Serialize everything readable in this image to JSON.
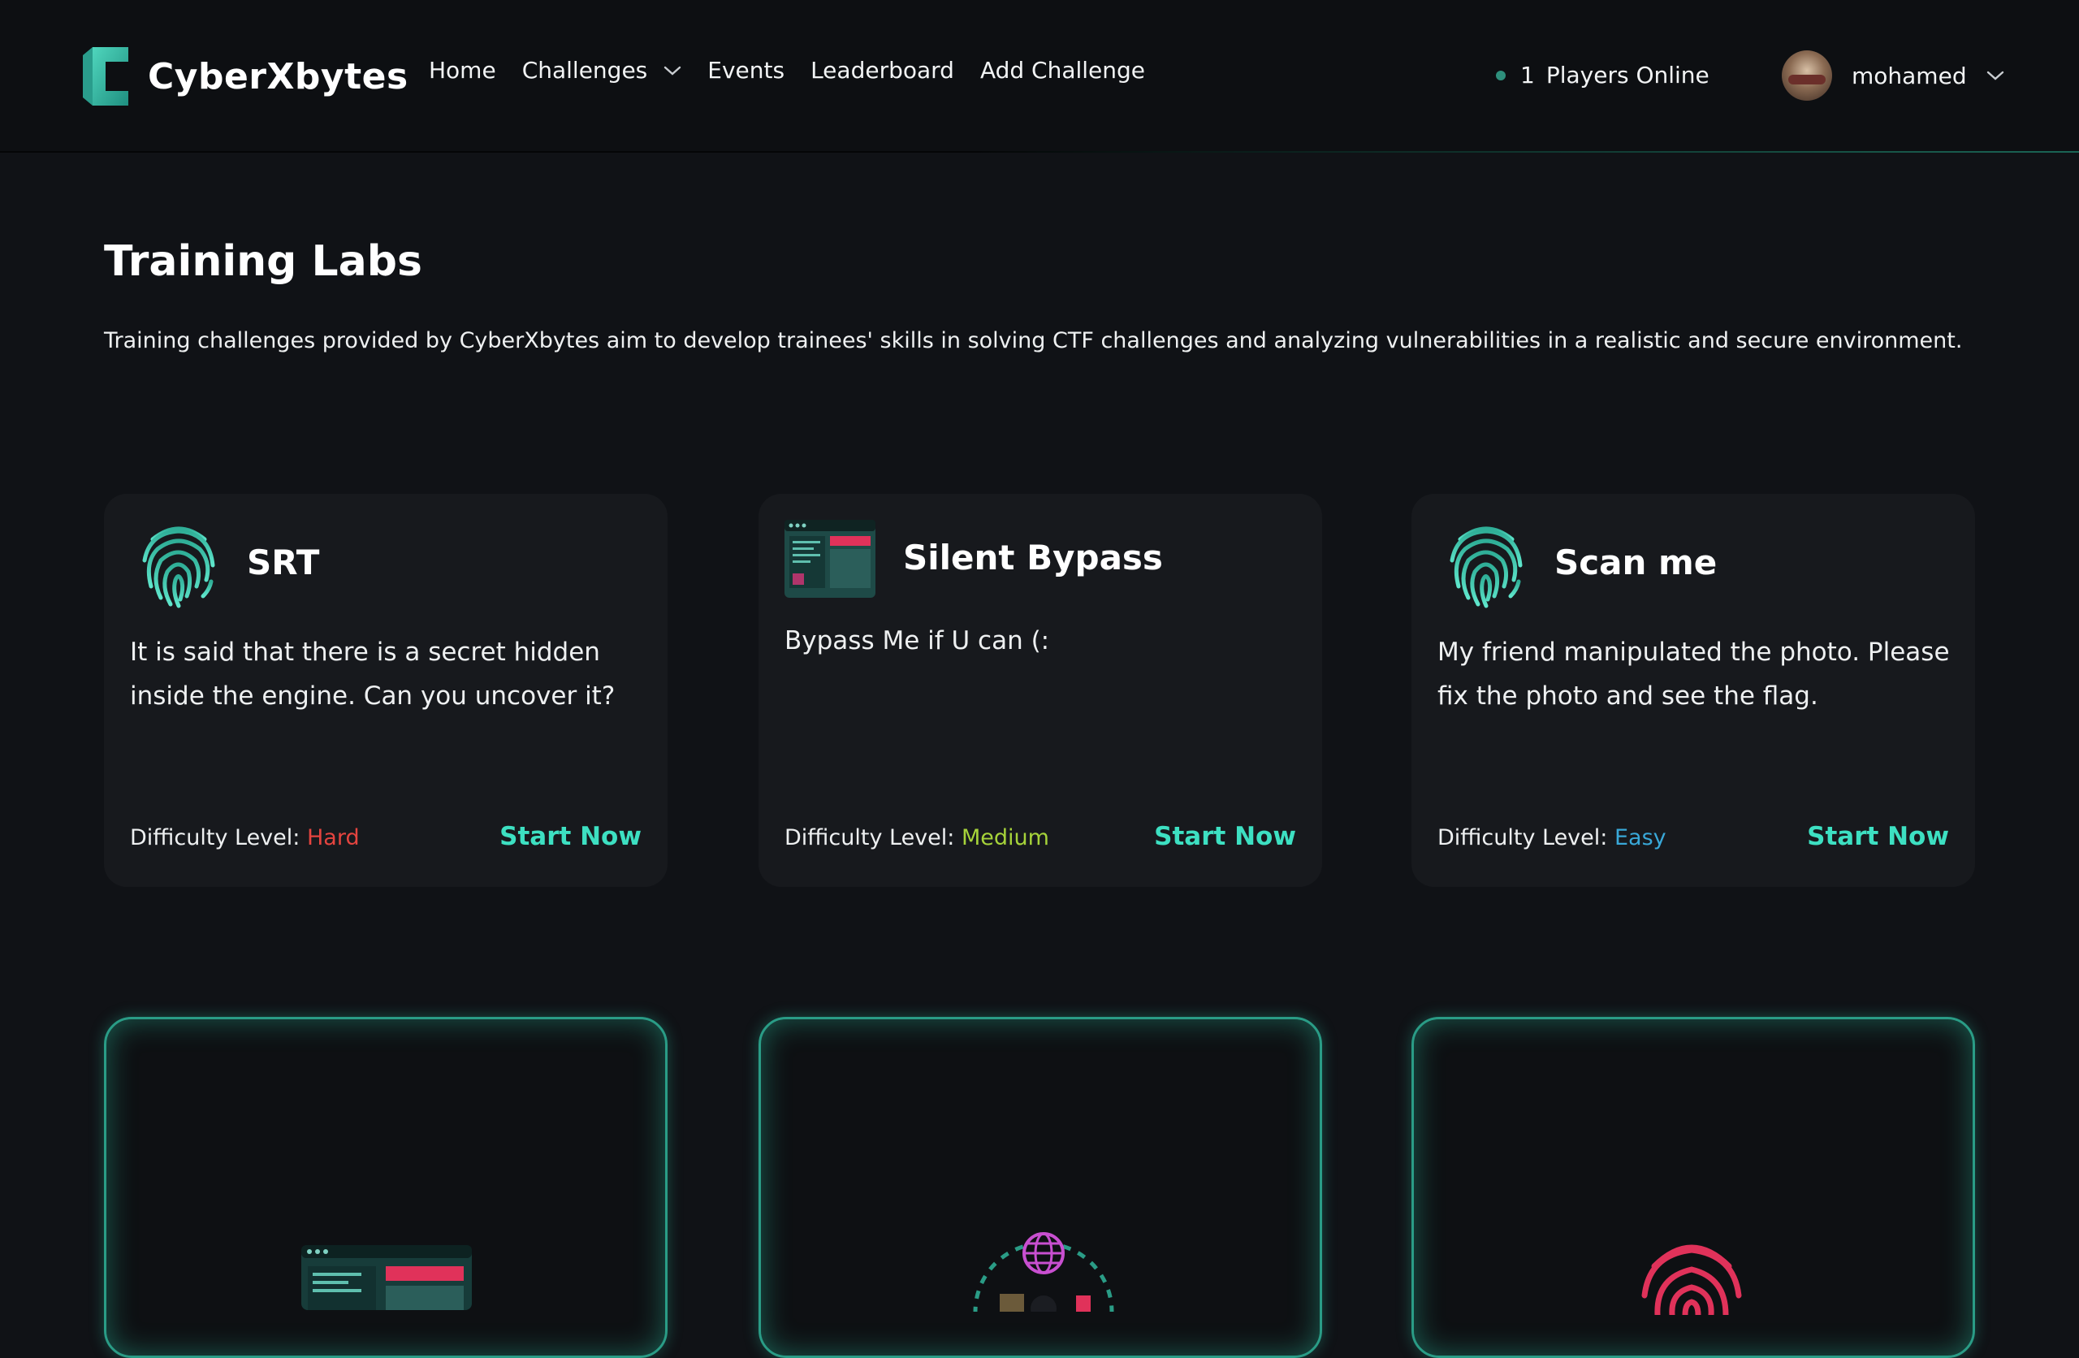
{
  "nav": {
    "brand": "CyberXbytes",
    "links": [
      {
        "label": "Home"
      },
      {
        "label": "Challenges"
      },
      {
        "label": "Events"
      },
      {
        "label": "Leaderboard"
      },
      {
        "label": "Add Challenge"
      }
    ],
    "players_online_count": "1",
    "players_online_label": "Players Online",
    "username": "mohamed"
  },
  "page": {
    "title": "Training Labs",
    "description": "Training challenges provided by CyberXbytes aim to develop trainees' skills in solving CTF challenges and analyzing vulnerabilities in a realistic and secure environment."
  },
  "cards": [
    {
      "title": "SRT",
      "description": "It is said that there is a secret hidden inside the engine. Can you uncover it?",
      "difficulty_label": "Difficulty Level:",
      "difficulty": "Hard",
      "button": "Start Now",
      "icon": "fingerprint-icon"
    },
    {
      "title": "Silent Bypass",
      "description": "Bypass Me if U can (:",
      "difficulty_label": "Difficulty Level:",
      "difficulty": "Medium",
      "button": "Start Now",
      "icon": "browser-window-icon"
    },
    {
      "title": "Scan me",
      "description": "My friend manipulated the photo. Please fix the photo and see the flag.",
      "difficulty_label": "Difficulty Level:",
      "difficulty": "Easy",
      "button": "Start Now",
      "icon": "fingerprint-icon"
    }
  ],
  "colors": {
    "accent": "#3de0c2",
    "hard": "#e5443f",
    "medium": "#a6d33a",
    "easy": "#39a8d8",
    "background": "#101216",
    "card": "#17191d"
  }
}
